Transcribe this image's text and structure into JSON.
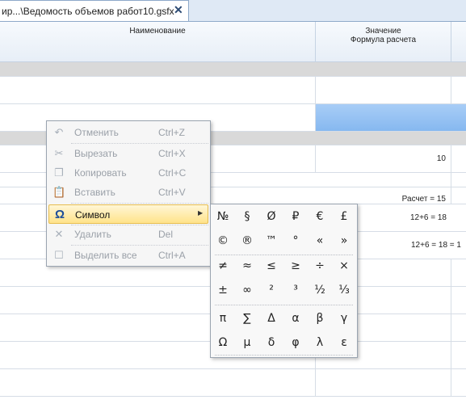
{
  "tab": {
    "title": "ир...\\Ведомость объемов работ10.gsfx",
    "close": "✕"
  },
  "header": {
    "name_col": "Наименование",
    "value_col_line1": "Значение",
    "value_col_line2": "Формула расчета"
  },
  "rows": [
    {
      "value": ""
    },
    {
      "value": ""
    },
    {
      "value": "10"
    },
    {
      "value": "Расчет = 15"
    },
    {
      "value": "12+6 = 18"
    },
    {
      "value": "12+6 = 18 = 1"
    }
  ],
  "context_menu": {
    "items": [
      {
        "label": "Отменить",
        "shortcut": "Ctrl+Z",
        "icon": "undo-icon",
        "glyph": "↶"
      },
      {
        "label": "Вырезать",
        "shortcut": "Ctrl+X",
        "icon": "scissors-icon",
        "glyph": "✂"
      },
      {
        "label": "Копировать",
        "shortcut": "Ctrl+C",
        "icon": "copy-icon",
        "glyph": "❐"
      },
      {
        "label": "Вставить",
        "shortcut": "Ctrl+V",
        "icon": "paste-icon",
        "glyph": "📋"
      },
      {
        "label": "Символ",
        "shortcut": "",
        "icon": "omega-icon",
        "glyph": "Ω",
        "arrow": "▶"
      },
      {
        "label": "Удалить",
        "shortcut": "Del",
        "icon": "delete-icon",
        "glyph": "✕"
      },
      {
        "label": "Выделить все",
        "shortcut": "Ctrl+A",
        "icon": "select-all-icon",
        "glyph": "☐"
      }
    ]
  },
  "symbols": [
    [
      "№",
      "§",
      "Ø",
      "₽",
      "€",
      "£"
    ],
    [
      "©",
      "®",
      "™",
      "°",
      "«",
      "»"
    ],
    [
      "≠",
      "≈",
      "≤",
      "≥",
      "÷",
      "×"
    ],
    [
      "±",
      "∞",
      "²",
      "³",
      "½",
      "⅓"
    ],
    [
      "π",
      "∑",
      "Δ",
      "α",
      "β",
      "γ"
    ],
    [
      "Ω",
      "μ",
      "δ",
      "φ",
      "λ",
      "ε"
    ]
  ]
}
